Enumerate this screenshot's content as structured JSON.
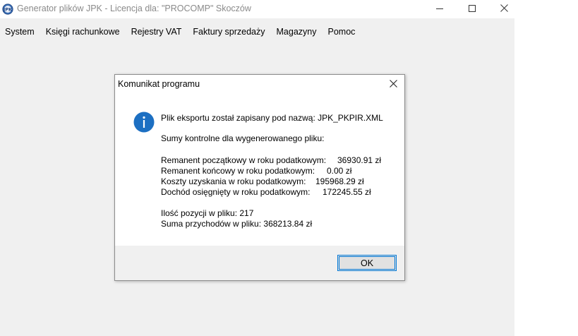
{
  "window": {
    "title": "Generator plików JPK - Licencja dla: \"PROCOMP\" Skoczów",
    "controls": [
      "minimize-icon",
      "maximize-icon",
      "close-icon"
    ]
  },
  "menu": {
    "items": [
      "System",
      "Księgi rachunkowe",
      "Rejestry VAT",
      "Faktury sprzedaży",
      "Magazyny",
      "Pomoc"
    ]
  },
  "dialog": {
    "title": "Komunikat programu",
    "icon": "info-icon",
    "export_line": "Plik eksportu został zapisany pod nazwą: JPK_PKPIR.XML",
    "checksums_header": "Sumy kontrolne dla wygenerowanego pliku:",
    "rows": [
      {
        "label": "Remanent początkowy w roku podatkowym:",
        "value": "36930.91 zł"
      },
      {
        "label": "Remanent końcowy w roku podatkowym:",
        "value": "0.00 zł"
      },
      {
        "label": "Koszty uzyskania w roku podatkowym:",
        "value": "195968.29 zł"
      },
      {
        "label": "Dochód osięgnięty w roku podatkowym:",
        "value": "172245.55 zł"
      }
    ],
    "count_line": "Ilość pozycji w pliku: 217",
    "sum_line": "Suma przychodów w pliku: 368213.84 zł",
    "ok_label": "OK"
  },
  "colors": {
    "accent": "#0078d7",
    "info_icon": "#1c6fc2",
    "app_background": "#f0f0f0"
  }
}
